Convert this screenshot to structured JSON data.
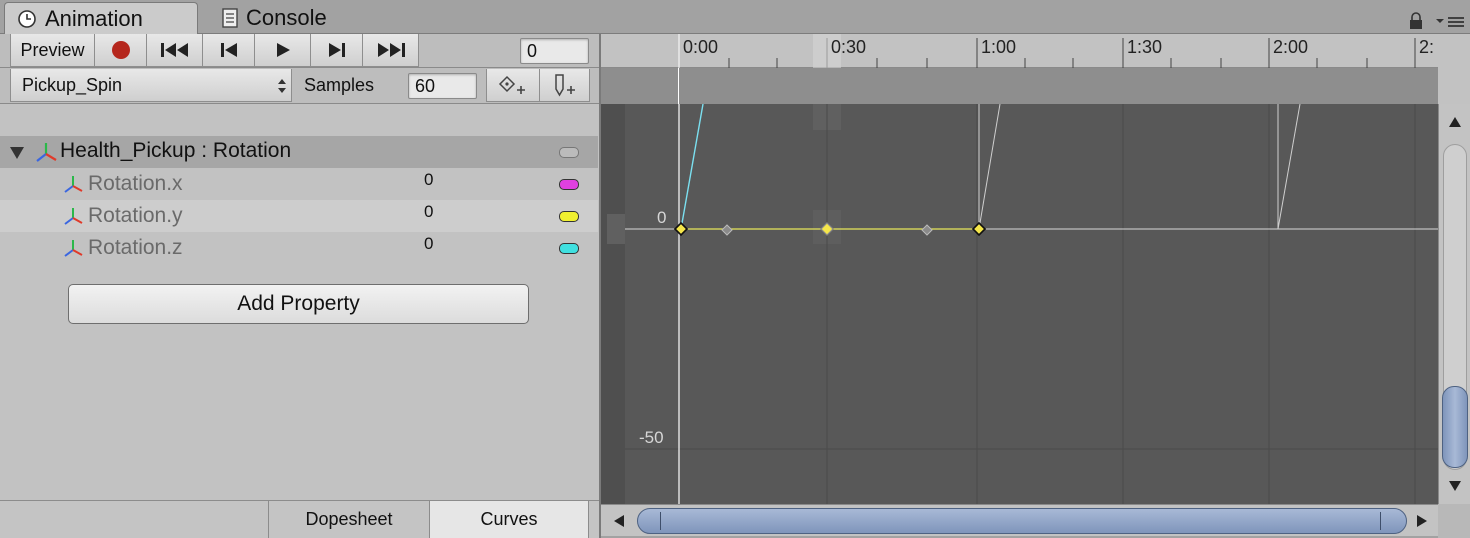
{
  "tabs": [
    {
      "label": "Animation",
      "icon": "clock-icon",
      "active": true
    },
    {
      "label": "Console",
      "icon": "document-icon",
      "active": false
    }
  ],
  "toolbar": {
    "preview_label": "Preview",
    "frame_value": "0",
    "record_color": "#b5271d"
  },
  "clip": {
    "name": "Pickup_Spin",
    "samples_label": "Samples",
    "samples_value": "60"
  },
  "hierarchy": {
    "parent_label": "Health_Pickup : Rotation",
    "properties": [
      {
        "label": "Rotation.x",
        "value": "0",
        "color": "#e040e0"
      },
      {
        "label": "Rotation.y",
        "value": "0",
        "color": "#f0f030"
      },
      {
        "label": "Rotation.z",
        "value": "0",
        "color": "#40e0e0"
      }
    ]
  },
  "add_property_label": "Add Property",
  "bottom_tabs": {
    "dopesheet": "Dopesheet",
    "curves": "Curves"
  },
  "timeline": {
    "ticks": [
      "0:00",
      "0:30",
      "1:00",
      "1:30",
      "2:00",
      "2:"
    ],
    "y_labels": [
      "0",
      "-50"
    ]
  },
  "colors": {
    "accent_yellow": "#f5e64a",
    "graph_bg": "#545454",
    "curve_cyan": "#7be0f0"
  }
}
